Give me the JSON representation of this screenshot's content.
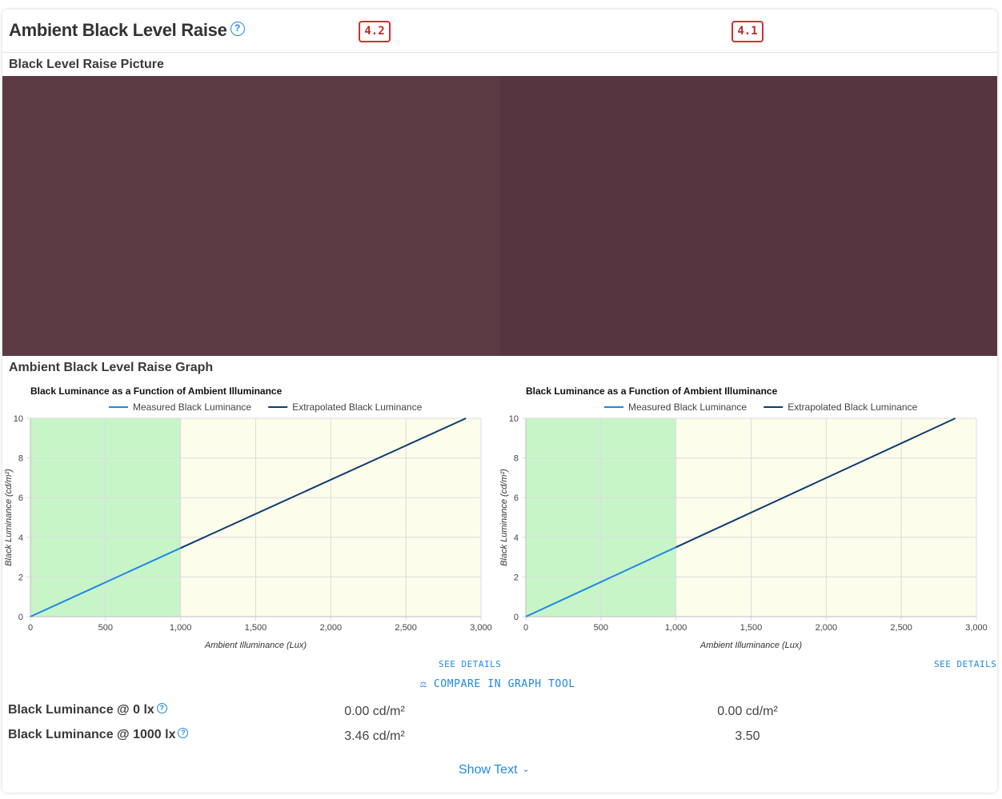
{
  "header": {
    "title": "Ambient Black Level Raise",
    "help_icon": "help-circle-icon",
    "scores": [
      "4.2",
      "4.1"
    ]
  },
  "sections": {
    "picture_label": "Black Level Raise Picture",
    "graph_label": "Ambient Black Level Raise Graph"
  },
  "picture": {
    "left_color": "#5c3a43",
    "right_color": "#573540"
  },
  "chart_data": [
    {
      "type": "line",
      "title": "Black Luminance as a Function of Ambient Illuminance",
      "xlabel": "Ambient Illuminance (Lux)",
      "ylabel": "Black Luminance (cd/m²)",
      "xlim": [
        0,
        3000
      ],
      "ylim": [
        0,
        10
      ],
      "x_ticks": [
        "0",
        "500",
        "1,000",
        "1,500",
        "2,000",
        "2,500",
        "3,000"
      ],
      "y_ticks": [
        "0",
        "2",
        "4",
        "6",
        "8",
        "10"
      ],
      "shaded_ranges": [
        {
          "from": 0,
          "to": 1000,
          "color": "#c8f5c8"
        },
        {
          "from": 1000,
          "to": 3000,
          "color": "#fdfdec"
        }
      ],
      "series": [
        {
          "name": "Measured Black Luminance",
          "color": "#1e88e5",
          "x": [
            0,
            1000
          ],
          "y": [
            0,
            3.46
          ]
        },
        {
          "name": "Extrapolated Black Luminance",
          "color": "#0d3c6e",
          "x": [
            1000,
            2900
          ],
          "y": [
            3.46,
            10
          ]
        }
      ],
      "grid": true,
      "legend": "top"
    },
    {
      "type": "line",
      "title": "Black Luminance as a Function of Ambient Illuminance",
      "xlabel": "Ambient Illuminance (Lux)",
      "ylabel": "Black Luminance (cd/m²)",
      "xlim": [
        0,
        3000
      ],
      "ylim": [
        0,
        10
      ],
      "x_ticks": [
        "0",
        "500",
        "1,000",
        "1,500",
        "2,000",
        "2,500",
        "3,000"
      ],
      "y_ticks": [
        "0",
        "2",
        "4",
        "6",
        "8",
        "10"
      ],
      "shaded_ranges": [
        {
          "from": 0,
          "to": 1000,
          "color": "#c8f5c8"
        },
        {
          "from": 1000,
          "to": 3000,
          "color": "#fdfdec"
        }
      ],
      "series": [
        {
          "name": "Measured Black Luminance",
          "color": "#1e88e5",
          "x": [
            0,
            1000
          ],
          "y": [
            0,
            3.5
          ]
        },
        {
          "name": "Extrapolated Black Luminance",
          "color": "#0d3c6e",
          "x": [
            1000,
            2860
          ],
          "y": [
            3.5,
            10
          ]
        }
      ],
      "grid": true,
      "legend": "top"
    }
  ],
  "links": {
    "see_details": "SEE DETAILS",
    "compare": "COMPARE IN GRAPH TOOL",
    "compare_icon": "scale-balance-icon",
    "show_text": "Show Text",
    "show_text_icon": "chevron-down-icon"
  },
  "metrics": [
    {
      "label": "Black Luminance @ 0 lx",
      "values": [
        "0.00 cd/m²",
        "0.00 cd/m²"
      ]
    },
    {
      "label": "Black Luminance @ 1000 lx",
      "values": [
        "3.46 cd/m²",
        "3.50"
      ]
    }
  ],
  "colors": {
    "accent": "#1e88e5",
    "score_border": "#d32f2f"
  }
}
